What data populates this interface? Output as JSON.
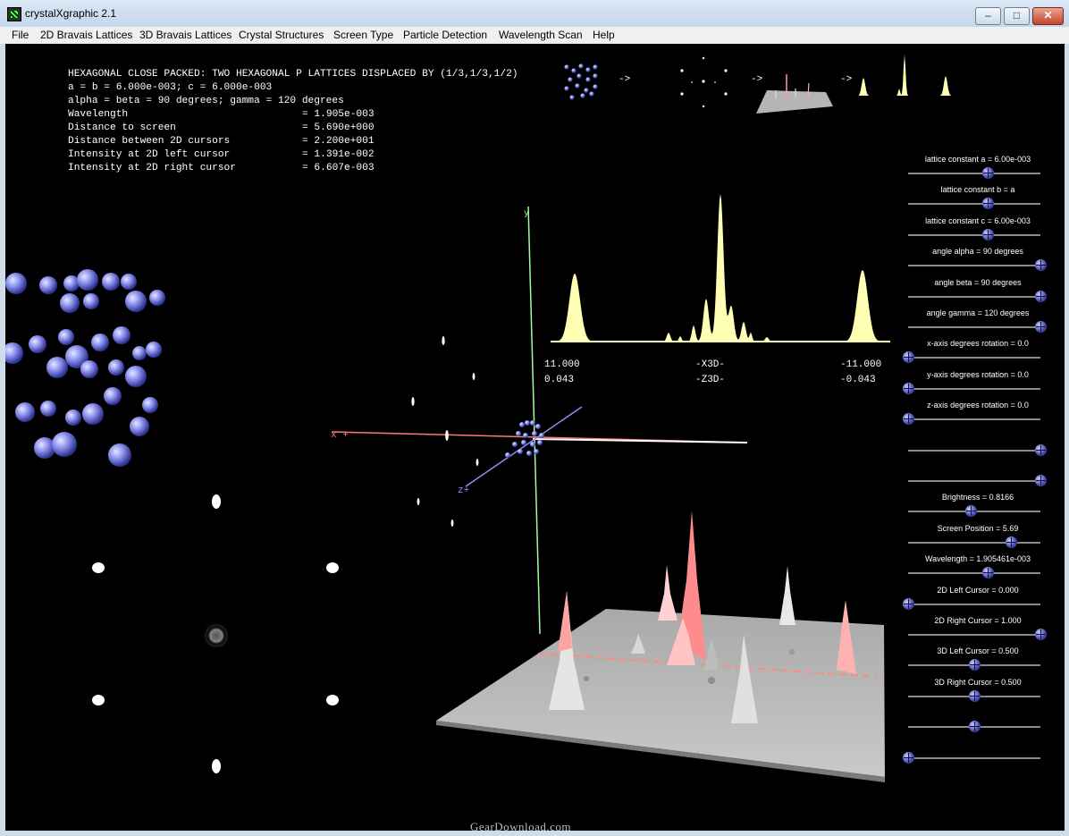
{
  "window": {
    "title": "crystalXgraphic 2.1"
  },
  "menu": [
    "File",
    "2D Bravais Lattices",
    "3D Bravais Lattices",
    "Crystal Structures",
    "Screen Type",
    "Particle Detection",
    "Wavelength Scan",
    "Help"
  ],
  "info": {
    "header": "HEXAGONAL CLOSE PACKED: TWO HEXAGONAL P LATTICES DISPLACED BY (1/3,1/3,1/2)",
    "lines": [
      "a = b = 6.000e-003; c = 6.000e-003",
      "alpha = beta = 90 degrees; gamma = 120 degrees"
    ],
    "params": [
      {
        "name": "Wavelength",
        "value": "= 1.905e-003"
      },
      {
        "name": "Distance to screen",
        "value": "= 5.690e+000"
      },
      {
        "name": "Distance between 2D cursors",
        "value": "= 2.200e+001"
      },
      {
        "name": "Intensity at 2D left cursor",
        "value": "= 1.391e-002"
      },
      {
        "name": "Intensity at 2D right cursor",
        "value": "= 6.607e-003"
      }
    ]
  },
  "pipeline": {
    "arrow": "->"
  },
  "axis": {
    "top_left": "11.000",
    "top_mid": "-X3D-",
    "top_right": "-11.000",
    "bot_left": "0.043",
    "bot_mid": "-Z3D-",
    "bot_right": "-0.043"
  },
  "sliders": [
    {
      "label": "lattice constant a = 6.00e-003",
      "value": 0.6
    },
    {
      "label": "lattice constant b = a",
      "value": 0.6
    },
    {
      "label": "lattice constant c = 6.00e-003",
      "value": 0.6
    },
    {
      "label": "angle alpha = 90 degrees",
      "value": 1.0
    },
    {
      "label": "angle beta = 90 degrees",
      "value": 1.0
    },
    {
      "label": "angle gamma = 120 degrees",
      "value": 1.0
    },
    {
      "label": "x-axis degrees rotation = 0.0",
      "value": 0.0
    },
    {
      "label": "y-axis degrees rotation = 0.0",
      "value": 0.0
    },
    {
      "label": "z-axis degrees rotation = 0.0",
      "value": 0.0
    },
    {
      "label": "",
      "value": 1.0
    },
    {
      "label": "",
      "value": 1.0
    },
    {
      "label": "Brightness = 0.8166",
      "value": 0.47
    },
    {
      "label": "Screen Position = 5.69",
      "value": 0.78
    },
    {
      "label": "Wavelength = 1.905461e-003",
      "value": 0.6
    },
    {
      "label": "2D Left Cursor = 0.000",
      "value": 0.0
    },
    {
      "label": "2D Right Cursor = 1.000",
      "value": 1.0
    },
    {
      "label": "3D Left Cursor = 0.500",
      "value": 0.5
    },
    {
      "label": "3D Right Cursor = 0.500",
      "value": 0.5
    },
    {
      "label": "",
      "value": 0.5
    },
    {
      "label": "",
      "value": 0.0
    }
  ],
  "watermark": "GearDownload.com",
  "colors": {
    "background": "#000000",
    "atom": "#7f86ee",
    "peak": "#ffffb4",
    "red_axis": "#ff7a6e",
    "green_axis": "#9cff9c",
    "blue_axis": "#8a8dff"
  }
}
